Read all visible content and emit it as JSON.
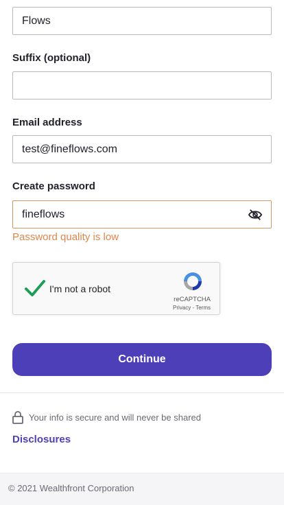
{
  "fields": {
    "top_field_value": "Flows",
    "suffix_label": "Suffix (optional)",
    "suffix_value": "",
    "email_label": "Email address",
    "email_value": "test@fineflows.com",
    "password_label": "Create password",
    "password_value": "fineflows",
    "password_quality": "Password quality is low"
  },
  "captcha": {
    "label": "I'm not a robot",
    "brand": "reCAPTCHA",
    "links": "Privacy - Terms"
  },
  "actions": {
    "continue_label": "Continue"
  },
  "security": {
    "note": "Your info is secure and will never be shared",
    "disclosures_label": "Disclosures"
  },
  "footer": {
    "copyright": "© 2021 Wealthfront Corporation"
  },
  "colors": {
    "accent": "#4d3fb8",
    "warning": "#e0864a",
    "check_green": "#1e9e55"
  }
}
